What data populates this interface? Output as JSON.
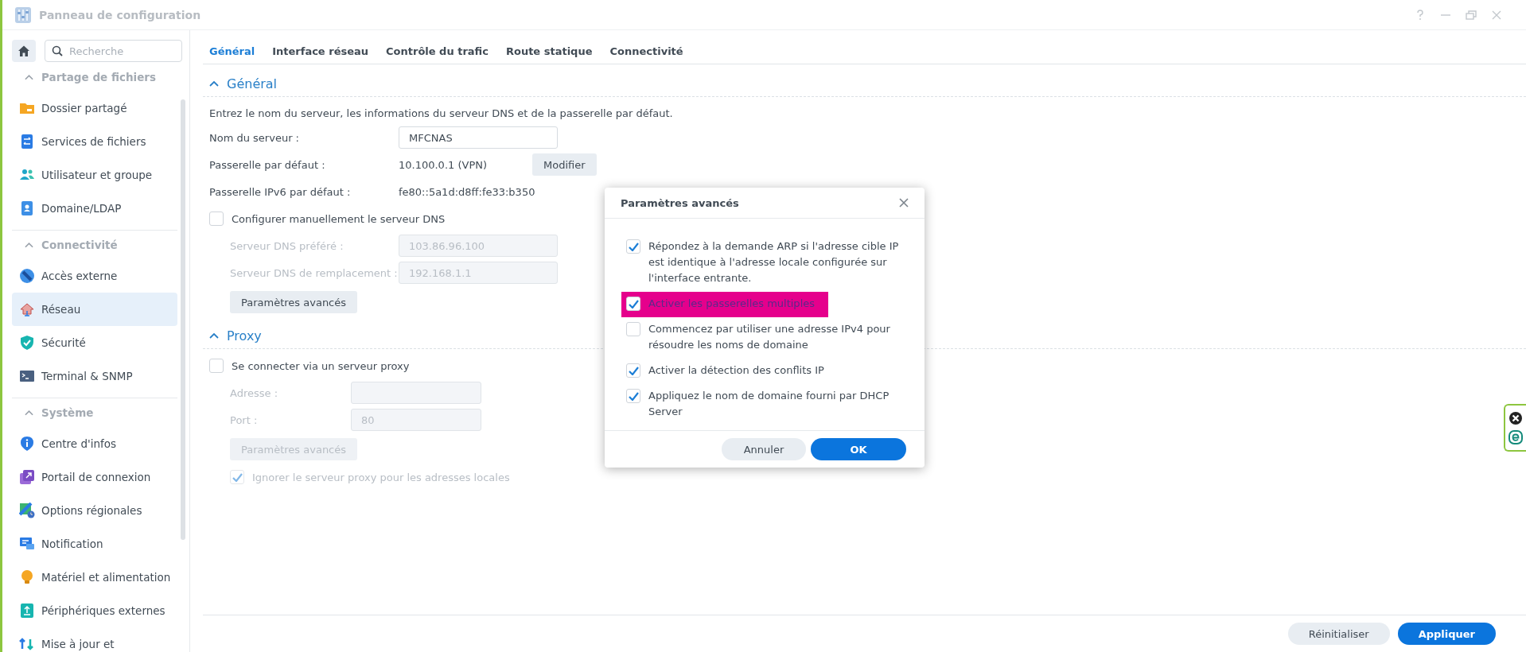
{
  "window": {
    "title": "Panneau de configuration"
  },
  "sidebar": {
    "search": {
      "placeholder": "Recherche"
    },
    "sections": [
      {
        "title": "Partage de fichiers",
        "expanded": true,
        "items": [
          {
            "label": "Dossier partagé",
            "selected": false
          },
          {
            "label": "Services de fichiers",
            "selected": false
          },
          {
            "label": "Utilisateur et groupe",
            "selected": false
          },
          {
            "label": "Domaine/LDAP",
            "selected": false
          }
        ]
      },
      {
        "title": "Connectivité",
        "expanded": true,
        "items": [
          {
            "label": "Accès externe",
            "selected": false
          },
          {
            "label": "Réseau",
            "selected": true
          },
          {
            "label": "Sécurité",
            "selected": false
          },
          {
            "label": "Terminal & SNMP",
            "selected": false
          }
        ]
      },
      {
        "title": "Système",
        "expanded": true,
        "items": [
          {
            "label": "Centre d'infos",
            "selected": false
          },
          {
            "label": "Portail de connexion",
            "selected": false
          },
          {
            "label": "Options régionales",
            "selected": false
          },
          {
            "label": "Notification",
            "selected": false
          },
          {
            "label": "Matériel et alimentation",
            "selected": false
          },
          {
            "label": "Périphériques externes",
            "selected": false
          },
          {
            "label": "Mise à jour et",
            "selected": false
          }
        ]
      }
    ]
  },
  "tabs": [
    {
      "label": "Général",
      "selected": true
    },
    {
      "label": "Interface réseau",
      "selected": false
    },
    {
      "label": "Contrôle du trafic",
      "selected": false
    },
    {
      "label": "Route statique",
      "selected": false
    },
    {
      "label": "Connectivité",
      "selected": false
    }
  ],
  "general": {
    "title": "Général",
    "expanded": true,
    "description": "Entrez le nom du serveur, les informations du serveur DNS et de la passerelle par défaut.",
    "rows": [
      {
        "kind": "input",
        "label": "Nom du serveur :",
        "value": "MFCNAS"
      },
      {
        "kind": "text",
        "label": "Passerelle par défaut :",
        "value": "10.100.0.1 (VPN)",
        "button": "Modifier"
      },
      {
        "kind": "text",
        "label": "Passerelle IPv6 par défaut :",
        "value": "fe80::5a1d:d8ff:fe33:b350"
      }
    ],
    "dns": {
      "label": "Configurer manuellement le serveur DNS",
      "checked": false,
      "fields": [
        {
          "label": "Serveur DNS préféré :",
          "value": "103.86.96.100",
          "disabled": true
        },
        {
          "label": "Serveur DNS de remplacement :",
          "value": "192.168.1.1",
          "disabled": true
        }
      ],
      "button": {
        "label": "Paramètres avancés",
        "disabled": false
      }
    }
  },
  "proxy": {
    "title": "Proxy",
    "expanded": true,
    "checkbox": {
      "label": "Se connecter via un serveur proxy",
      "checked": false
    },
    "fields": [
      {
        "label": "Adresse :",
        "disabled": true
      },
      {
        "label": "Port :",
        "value": "80",
        "disabled": true
      }
    ],
    "button": {
      "label": "Paramètres avancés",
      "disabled": true
    },
    "bypass": {
      "label": "Ignorer le serveur proxy pour les adresses locales",
      "checked": true,
      "disabled": true
    }
  },
  "footer": {
    "buttons": [
      {
        "label": "Réinitialiser",
        "kind": "secondary"
      },
      {
        "label": "Appliquer",
        "kind": "primary"
      }
    ]
  },
  "dialog": {
    "title": "Paramètres avancés",
    "options": [
      {
        "label": "Répondez à la demande ARP si l'adresse cible IP est identique à l'adresse locale configurée sur l'interface entrante.",
        "checked": true,
        "highlighted": false
      },
      {
        "label": "Activer les passerelles multiples",
        "checked": true,
        "highlighted": true
      },
      {
        "label": "Commencez par utiliser une adresse IPv4 pour résoudre les noms de domaine",
        "checked": false,
        "highlighted": false
      },
      {
        "label": "Activer la détection des conflits IP",
        "checked": true,
        "highlighted": false
      },
      {
        "label": "Appliquez le nom de domaine fourni par DHCP Server",
        "checked": true,
        "highlighted": false
      }
    ],
    "buttons": [
      {
        "label": "Annuler",
        "kind": "secondary"
      },
      {
        "label": "OK",
        "kind": "primary"
      }
    ]
  }
}
